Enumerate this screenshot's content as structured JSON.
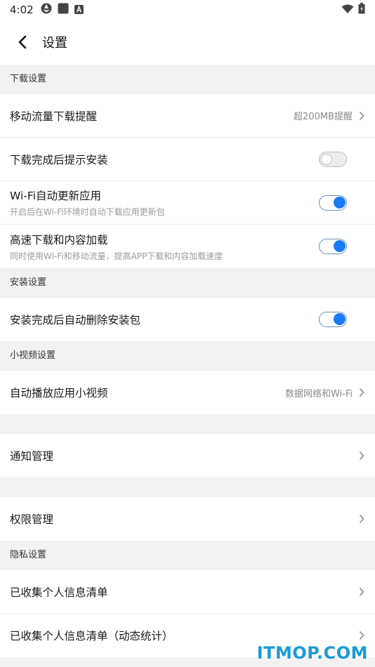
{
  "status_bar": {
    "time": "4:02",
    "icons": [
      "aperture-icon",
      "square-icon",
      "a-badge-icon",
      "wifi-icon",
      "battery-icon"
    ]
  },
  "header": {
    "title": "设置"
  },
  "sections": {
    "download": {
      "title": "下载设置",
      "mobile_data": {
        "label": "移动流量下载提醒",
        "value": "超200MB提醒"
      },
      "install_prompt": {
        "label": "下载完成后提示安装",
        "enabled": false
      },
      "wifi_update": {
        "label": "Wi-Fi自动更新应用",
        "sub": "开启后在Wi-Fi环境时自动下载应用更新包",
        "enabled": true
      },
      "high_speed": {
        "label": "高速下载和内容加载",
        "sub": "同时使用Wi-Fi和移动流量，提高APP下载和内容加载速度",
        "enabled": true
      }
    },
    "install": {
      "title": "安装设置",
      "auto_delete": {
        "label": "安装完成后自动删除安装包",
        "enabled": true
      }
    },
    "video": {
      "title": "小视频设置",
      "autoplay": {
        "label": "自动播放应用小视频",
        "value": "数据网络和Wi-Fi"
      }
    },
    "notification": {
      "label": "通知管理"
    },
    "permission": {
      "label": "权限管理"
    },
    "privacy": {
      "title": "隐私设置",
      "collected": {
        "label": "已收集个人信息清单"
      },
      "collected_dynamic": {
        "label": "已收集个人信息清单（动态统计）"
      }
    }
  },
  "watermark": "ITMOP.COM",
  "colors": {
    "accent": "#1a7cf5",
    "background": "#f2f2f2",
    "watermark": "#1a9bd7"
  }
}
